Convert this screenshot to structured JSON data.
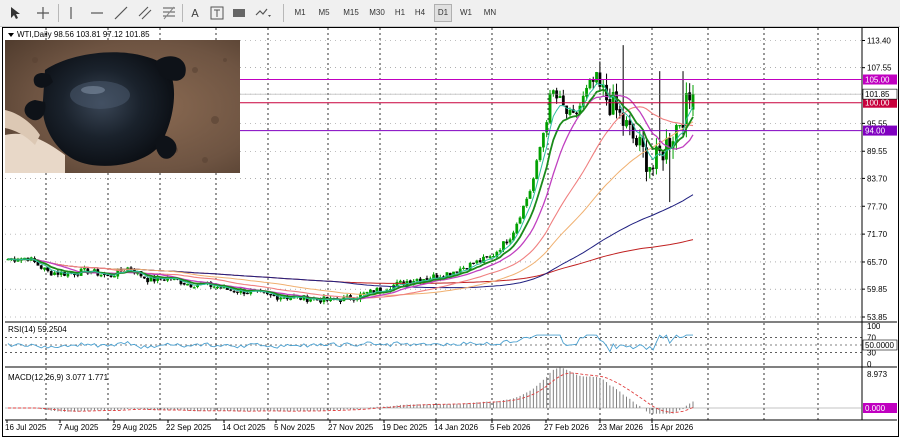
{
  "toolbar": {
    "icons": [
      "cursor-icon",
      "crosshair-icon",
      "vertical-line-icon",
      "horizontal-line-icon",
      "trendline-icon",
      "equidistant-channel-icon",
      "fibonacci-icon",
      "text-icon",
      "text-label-icon",
      "rectangle-icon",
      "shapes-icon"
    ],
    "text_tool_label": "A",
    "timeframes": [
      "M1",
      "M5",
      "M15",
      "M30",
      "H1",
      "H4",
      "D1",
      "W1",
      "MN"
    ],
    "active_timeframe": "D1"
  },
  "chart": {
    "header": "WTI,Daily  98.56 103.81 97.12 101.85",
    "price_ticks": [
      "113.40",
      "107.55",
      "101.85",
      "95.55",
      "89.55",
      "83.70",
      "77.70",
      "71.70",
      "65.70",
      "59.85",
      "53.85"
    ],
    "hlines": [
      {
        "price": "105.00",
        "color": "#c000c0",
        "label_bg": "#c000c0"
      },
      {
        "price": "100.00",
        "color": "#c8003c",
        "label_bg": "#c8003c"
      },
      {
        "price": "94.00",
        "color": "#8000c0",
        "label_bg": "#8000c0"
      }
    ],
    "current_price_label": "101.85",
    "date_labels": [
      "16 Jul 2025",
      "7 Aug 2025",
      "29 Aug 2025",
      "22 Sep 2025",
      "14 Oct 2025",
      "5 Nov 2025",
      "27 Nov 2025",
      "19 Dec 2025",
      "14 Jan 2026",
      "5 Feb 2026",
      "27 Feb 2026",
      "23 Mar 2026",
      "15 Apr 2026"
    ]
  },
  "rsi": {
    "header": "RSI(14) 59.2504",
    "ticks": [
      "100",
      "70",
      "50.0000",
      "30",
      "0"
    ],
    "value_label": "50.0000"
  },
  "macd": {
    "header": "MACD(12,26,9) 3.077 1.771",
    "ticks": [
      "8.973",
      "0.000"
    ],
    "value_label": "0.000"
  },
  "colors": {
    "bull": "#00a000",
    "bear": "#000000",
    "ma_green": "#1a8a1a",
    "ma_teal": "#2fbfa0",
    "ma_magenta": "#c040c0",
    "ma_salmon": "#f08080",
    "ma_orange": "#f0b070",
    "ma_navy": "#202080",
    "ma_red": "#c02020",
    "rsi_line": "#4aa0d0",
    "macd_hist": "#808080",
    "macd_signal": "#e04040"
  },
  "chart_data": {
    "type": "candlestick",
    "instrument": "WTI",
    "timeframe": "Daily",
    "ohlc_last": {
      "open": 98.56,
      "high": 103.81,
      "low": 97.12,
      "close": 101.85
    },
    "ylim": [
      53.85,
      113.4
    ],
    "x_labels": [
      "16 Jul 2025",
      "7 Aug 2025",
      "29 Aug 2025",
      "22 Sep 2025",
      "14 Oct 2025",
      "5 Nov 2025",
      "27 Nov 2025",
      "19 Dec 2025",
      "14 Jan 2026",
      "5 Feb 2026",
      "27 Feb 2026",
      "23 Mar 2026",
      "15 Apr 2026"
    ],
    "approx_close_path": [
      66.3,
      66.6,
      63.5,
      63.2,
      63.8,
      62.6,
      64.5,
      61.8,
      62.3,
      60.9,
      60.7,
      59.7,
      59.2,
      58.4,
      58.1,
      57.8,
      57.4,
      57.9,
      59.2,
      60.5,
      61.8,
      62.4,
      63.5,
      65.2,
      66.8,
      71.5,
      82.0,
      102.5,
      96.0,
      104.5,
      99.5,
      92.5,
      86.0,
      93.5,
      101.85
    ],
    "horizontal_levels": [
      105.0,
      100.0,
      94.0
    ],
    "rsi": {
      "period": 14,
      "value": 59.2504,
      "levels": [
        70,
        50,
        30
      ],
      "range": [
        0,
        100
      ]
    },
    "macd": {
      "fast": 12,
      "slow": 26,
      "signal": 9,
      "main": 3.077,
      "signal_value": 1.771,
      "ymax": 8.973
    }
  }
}
